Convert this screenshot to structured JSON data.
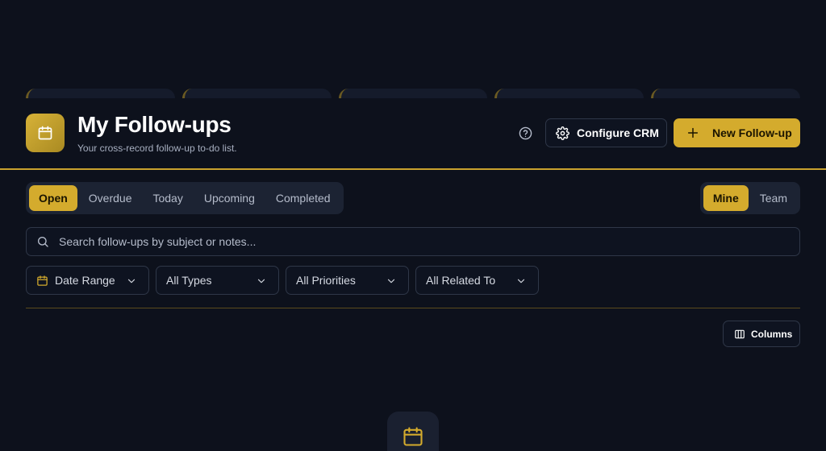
{
  "header": {
    "title": "My Follow-ups",
    "subtitle": "Your cross-record follow-up to-do list.",
    "configure_label": "Configure CRM",
    "new_label": "New Follow-up"
  },
  "tabs": [
    "Open",
    "Overdue",
    "Today",
    "Upcoming",
    "Completed"
  ],
  "scope": [
    "Mine",
    "Team"
  ],
  "search": {
    "placeholder": "Search follow-ups by subject or notes..."
  },
  "filters": {
    "date": "Date Range",
    "types": "All Types",
    "priorities": "All Priorities",
    "related": "All Related To"
  },
  "columns_label": "Columns",
  "colors": {
    "accent": "#d4ab2d",
    "background": "#0d111c",
    "surface": "#1c2333"
  },
  "icons": [
    "calendar-icon",
    "help-icon",
    "gear-icon",
    "plus-icon",
    "search-icon",
    "chevron-down-icon",
    "columns-icon"
  ]
}
